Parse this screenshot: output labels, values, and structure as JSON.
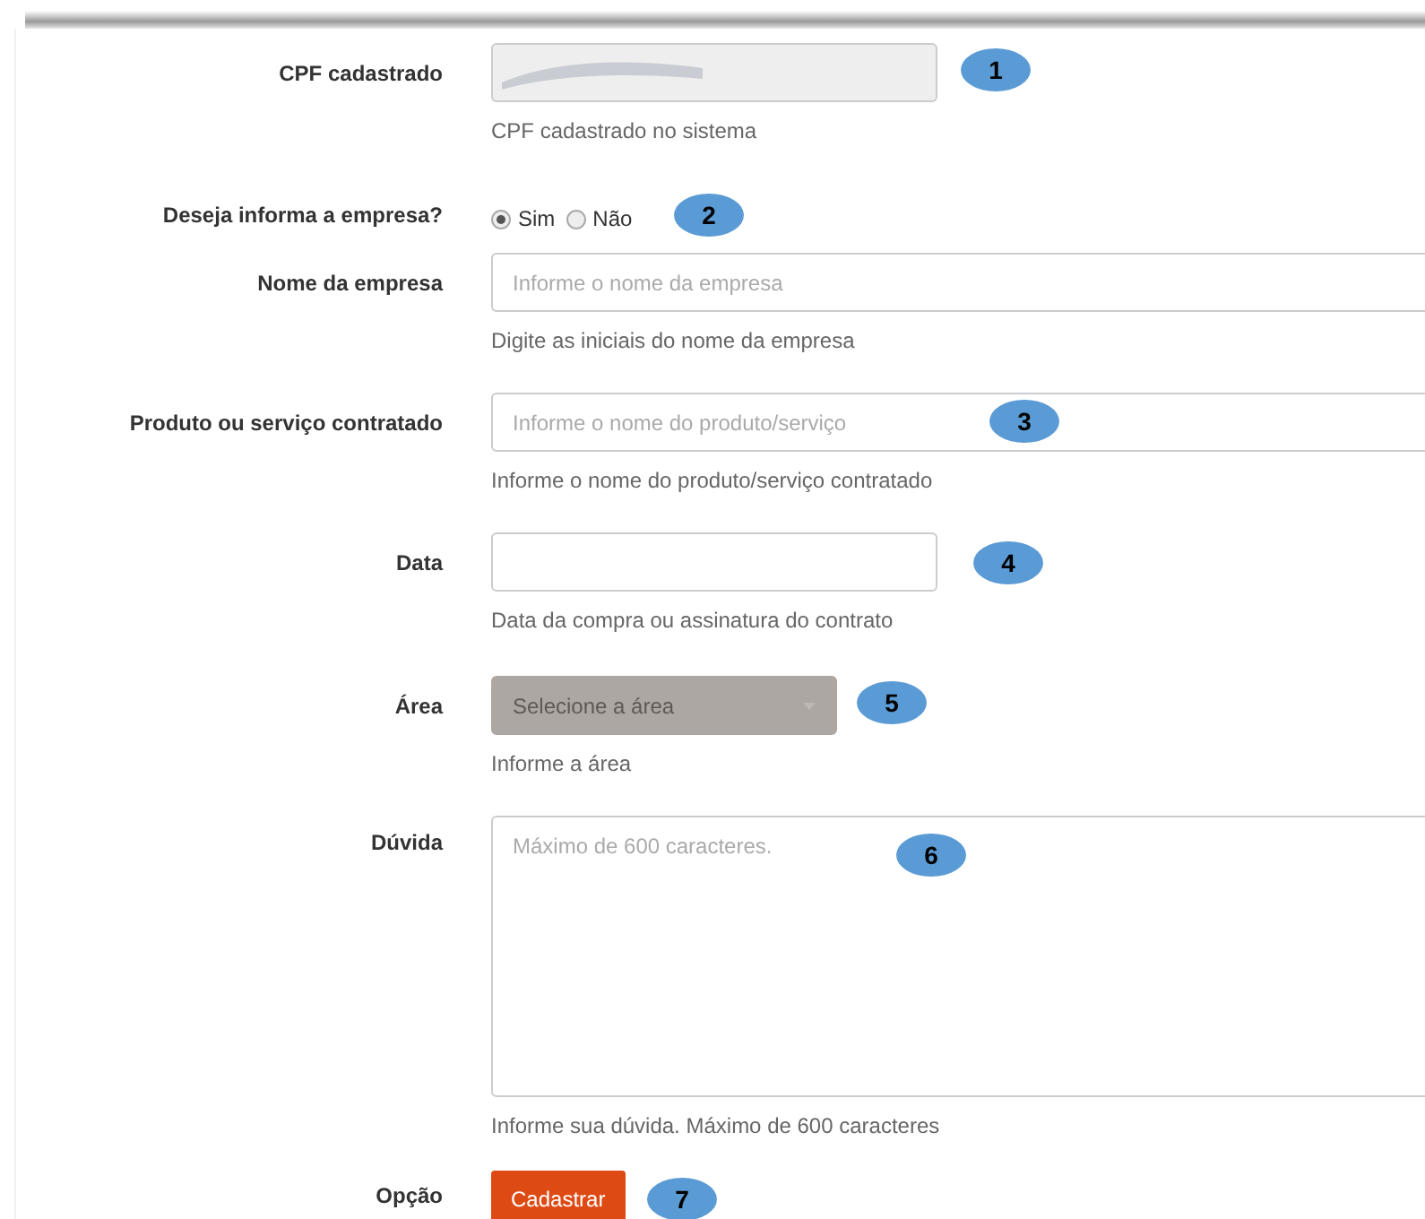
{
  "fields": [
    {
      "kind": "readonly",
      "label": "CPF cadastrado",
      "help": "CPF cadastrado no sistema",
      "badge": "1",
      "redacted": true
    },
    {
      "kind": "radio",
      "label": "Deseja informa a empresa?",
      "badge": "2",
      "options": [
        {
          "label": "Sim",
          "selected": true
        },
        {
          "label": "Não",
          "selected": false
        }
      ]
    },
    {
      "kind": "text",
      "label": "Nome da empresa",
      "placeholder": "Informe o nome da empresa",
      "help": "Digite as iniciais do nome da empresa"
    },
    {
      "kind": "text",
      "label": "Produto ou serviço contratado",
      "placeholder": "Informe o nome do produto/serviço",
      "help": "Informe o nome do produto/serviço contratado",
      "badge": "3"
    },
    {
      "kind": "date",
      "label": "Data",
      "help": "Data da compra ou assinatura do contrato",
      "badge": "4"
    },
    {
      "kind": "select",
      "label": "Área",
      "placeholder": "Selecione a área",
      "help": "Informe a área",
      "badge": "5",
      "disabled": true
    },
    {
      "kind": "textarea",
      "label": "Dúvida",
      "placeholder": "Máximo de 600 caracteres.",
      "help": "Informe sua dúvida. Máximo de 600 caracteres",
      "badge": "6"
    },
    {
      "kind": "button",
      "label": "Opção",
      "button": "Cadastrar",
      "badge": "7"
    }
  ]
}
